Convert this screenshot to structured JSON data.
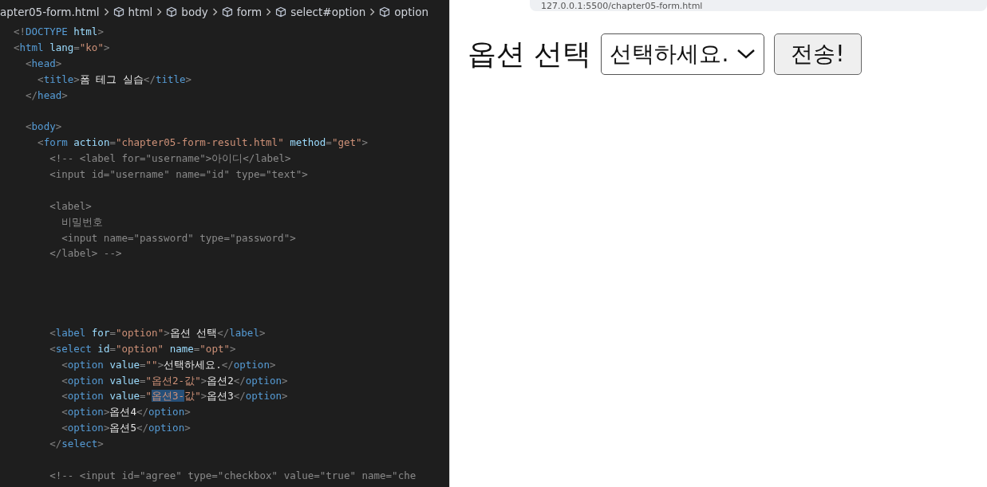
{
  "editor": {
    "breadcrumb": [
      {
        "label": "apter05-form.html",
        "kind": "file"
      },
      {
        "label": "html",
        "kind": "element"
      },
      {
        "label": "body",
        "kind": "element"
      },
      {
        "label": "form",
        "kind": "element"
      },
      {
        "label": "select#option",
        "kind": "element"
      },
      {
        "label": "option",
        "kind": "element"
      }
    ],
    "lines": [
      {
        "kind": "code",
        "tokens": [
          {
            "kind": "punct",
            "text": "<!"
          },
          {
            "kind": "tag",
            "text": "DOCTYPE"
          },
          {
            "kind": "attr",
            "text": " html"
          },
          {
            "kind": "punct",
            "text": ">"
          }
        ]
      },
      {
        "kind": "code",
        "tokens": [
          {
            "kind": "punct",
            "text": "<"
          },
          {
            "kind": "tag",
            "text": "html"
          },
          {
            "kind": "attr",
            "text": " lang"
          },
          {
            "kind": "punct",
            "text": "="
          },
          {
            "kind": "string",
            "text": "\"ko\""
          },
          {
            "kind": "punct",
            "text": ">"
          }
        ],
        "children": [
          {
            "kind": "code",
            "tokens": [
              {
                "kind": "punct",
                "text": "<"
              },
              {
                "kind": "tag",
                "text": "head"
              },
              {
                "kind": "punct",
                "text": ">"
              }
            ],
            "children": [
              {
                "kind": "code",
                "tokens": [
                  {
                    "kind": "punct",
                    "text": "<"
                  },
                  {
                    "kind": "tag",
                    "text": "title"
                  },
                  {
                    "kind": "punct",
                    "text": ">"
                  },
                  {
                    "kind": "text",
                    "text": "폼 테그 실습"
                  },
                  {
                    "kind": "punct",
                    "text": "</"
                  },
                  {
                    "kind": "tag",
                    "text": "title"
                  },
                  {
                    "kind": "punct",
                    "text": ">"
                  }
                ]
              }
            ]
          },
          {
            "kind": "code",
            "tokens": [
              {
                "kind": "punct",
                "text": "</"
              },
              {
                "kind": "tag",
                "text": "head"
              },
              {
                "kind": "punct",
                "text": ">"
              }
            ]
          },
          {
            "kind": "blank"
          },
          {
            "kind": "code",
            "tokens": [
              {
                "kind": "punct",
                "text": "<"
              },
              {
                "kind": "tag",
                "text": "body"
              },
              {
                "kind": "punct",
                "text": ">"
              }
            ],
            "children": [
              {
                "kind": "code",
                "tokens": [
                  {
                    "kind": "punct",
                    "text": "<"
                  },
                  {
                    "kind": "tag",
                    "text": "form"
                  },
                  {
                    "kind": "attr",
                    "text": " action"
                  },
                  {
                    "kind": "punct",
                    "text": "="
                  },
                  {
                    "kind": "string",
                    "text": "\"chapter05-form-result.html\""
                  },
                  {
                    "kind": "attr",
                    "text": " method"
                  },
                  {
                    "kind": "punct",
                    "text": "="
                  },
                  {
                    "kind": "string",
                    "text": "\"get\""
                  },
                  {
                    "kind": "punct",
                    "text": ">"
                  }
                ],
                "children": [
                  {
                    "kind": "code",
                    "tokens": [
                      {
                        "kind": "comment",
                        "text": "<!-- <label for=\"username\">아이디</label>"
                      }
                    ]
                  },
                  {
                    "kind": "code",
                    "tokens": [
                      {
                        "kind": "comment",
                        "text": "<input id=\"username\" name=\"id\" type=\"text\">"
                      }
                    ]
                  },
                  {
                    "kind": "blank"
                  },
                  {
                    "kind": "code",
                    "tokens": [
                      {
                        "kind": "comment",
                        "text": "<label>"
                      }
                    ],
                    "children": [
                      {
                        "kind": "code",
                        "tokens": [
                          {
                            "kind": "comment",
                            "text": "비밀번호"
                          }
                        ]
                      },
                      {
                        "kind": "code",
                        "tokens": [
                          {
                            "kind": "comment",
                            "text": "<input name=\"password\" type=\"password\">"
                          }
                        ]
                      }
                    ]
                  },
                  {
                    "kind": "code",
                    "tokens": [
                      {
                        "kind": "comment",
                        "text": "</label> -->"
                      }
                    ]
                  },
                  {
                    "kind": "blank"
                  },
                  {
                    "kind": "blank"
                  },
                  {
                    "kind": "blank"
                  },
                  {
                    "kind": "blank"
                  },
                  {
                    "kind": "code",
                    "tokens": [
                      {
                        "kind": "punct",
                        "text": "<"
                      },
                      {
                        "kind": "tag",
                        "text": "label"
                      },
                      {
                        "kind": "attr",
                        "text": " for"
                      },
                      {
                        "kind": "punct",
                        "text": "="
                      },
                      {
                        "kind": "string",
                        "text": "\"option\""
                      },
                      {
                        "kind": "punct",
                        "text": ">"
                      },
                      {
                        "kind": "text",
                        "text": "옵션 선택"
                      },
                      {
                        "kind": "punct",
                        "text": "</"
                      },
                      {
                        "kind": "tag",
                        "text": "label"
                      },
                      {
                        "kind": "punct",
                        "text": ">"
                      }
                    ]
                  },
                  {
                    "kind": "code",
                    "tokens": [
                      {
                        "kind": "punct",
                        "text": "<"
                      },
                      {
                        "kind": "tag",
                        "text": "select"
                      },
                      {
                        "kind": "attr",
                        "text": " id"
                      },
                      {
                        "kind": "punct",
                        "text": "="
                      },
                      {
                        "kind": "string",
                        "text": "\"option\""
                      },
                      {
                        "kind": "attr",
                        "text": " name"
                      },
                      {
                        "kind": "punct",
                        "text": "="
                      },
                      {
                        "kind": "string",
                        "text": "\"opt\""
                      },
                      {
                        "kind": "punct",
                        "text": ">"
                      }
                    ],
                    "children": [
                      {
                        "kind": "code",
                        "tokens": [
                          {
                            "kind": "punct",
                            "text": "<"
                          },
                          {
                            "kind": "tag",
                            "text": "option"
                          },
                          {
                            "kind": "attr",
                            "text": " value"
                          },
                          {
                            "kind": "punct",
                            "text": "="
                          },
                          {
                            "kind": "string",
                            "text": "\"\""
                          },
                          {
                            "kind": "punct",
                            "text": ">"
                          },
                          {
                            "kind": "text",
                            "text": "선택하세요."
                          },
                          {
                            "kind": "punct",
                            "text": "</"
                          },
                          {
                            "kind": "tag",
                            "text": "option"
                          },
                          {
                            "kind": "punct",
                            "text": ">"
                          }
                        ]
                      },
                      {
                        "kind": "code",
                        "tokens": [
                          {
                            "kind": "punct",
                            "text": "<"
                          },
                          {
                            "kind": "tag",
                            "text": "option"
                          },
                          {
                            "kind": "attr",
                            "text": " value"
                          },
                          {
                            "kind": "punct",
                            "text": "="
                          },
                          {
                            "kind": "string",
                            "text": "\"옵션2-값\""
                          },
                          {
                            "kind": "punct",
                            "text": ">"
                          },
                          {
                            "kind": "text",
                            "text": "옵션2"
                          },
                          {
                            "kind": "punct",
                            "text": "</"
                          },
                          {
                            "kind": "tag",
                            "text": "option"
                          },
                          {
                            "kind": "punct",
                            "text": ">"
                          }
                        ]
                      },
                      {
                        "kind": "code",
                        "tokens": [
                          {
                            "kind": "punct",
                            "text": "<"
                          },
                          {
                            "kind": "tag",
                            "text": "option"
                          },
                          {
                            "kind": "attr",
                            "text": " value"
                          },
                          {
                            "kind": "punct",
                            "text": "="
                          },
                          {
                            "kind": "string",
                            "text": "\""
                          },
                          {
                            "kind": "selection",
                            "text": "옵션3-"
                          },
                          {
                            "kind": "string",
                            "text": "값\""
                          },
                          {
                            "kind": "punct",
                            "text": ">"
                          },
                          {
                            "kind": "text",
                            "text": "옵션3"
                          },
                          {
                            "kind": "punct",
                            "text": "</"
                          },
                          {
                            "kind": "tag",
                            "text": "option"
                          },
                          {
                            "kind": "punct",
                            "text": ">"
                          }
                        ]
                      },
                      {
                        "kind": "code",
                        "tokens": [
                          {
                            "kind": "punct",
                            "text": "<"
                          },
                          {
                            "kind": "tag",
                            "text": "option"
                          },
                          {
                            "kind": "punct",
                            "text": ">"
                          },
                          {
                            "kind": "text",
                            "text": "옵션4"
                          },
                          {
                            "kind": "punct",
                            "text": "</"
                          },
                          {
                            "kind": "tag",
                            "text": "option"
                          },
                          {
                            "kind": "punct",
                            "text": ">"
                          }
                        ]
                      },
                      {
                        "kind": "code",
                        "tokens": [
                          {
                            "kind": "punct",
                            "text": "<"
                          },
                          {
                            "kind": "tag",
                            "text": "option"
                          },
                          {
                            "kind": "punct",
                            "text": ">"
                          },
                          {
                            "kind": "text",
                            "text": "옵션5"
                          },
                          {
                            "kind": "punct",
                            "text": "</"
                          },
                          {
                            "kind": "tag",
                            "text": "option"
                          },
                          {
                            "kind": "punct",
                            "text": ">"
                          }
                        ]
                      }
                    ]
                  },
                  {
                    "kind": "code",
                    "tokens": [
                      {
                        "kind": "punct",
                        "text": "</"
                      },
                      {
                        "kind": "tag",
                        "text": "select"
                      },
                      {
                        "kind": "punct",
                        "text": ">"
                      }
                    ]
                  },
                  {
                    "kind": "blank"
                  },
                  {
                    "kind": "code",
                    "tokens": [
                      {
                        "kind": "comment",
                        "text": "<!-- <input id=\"agree\" type=\"checkbox\" value=\"true\" name=\"che"
                      }
                    ]
                  }
                ]
              }
            ]
          }
        ]
      }
    ]
  },
  "browser": {
    "url": "127.0.0.1:5500/chapter05-form.html",
    "label": "옵션 선택",
    "select_value": "선택하세요.",
    "submit": "전송!"
  }
}
